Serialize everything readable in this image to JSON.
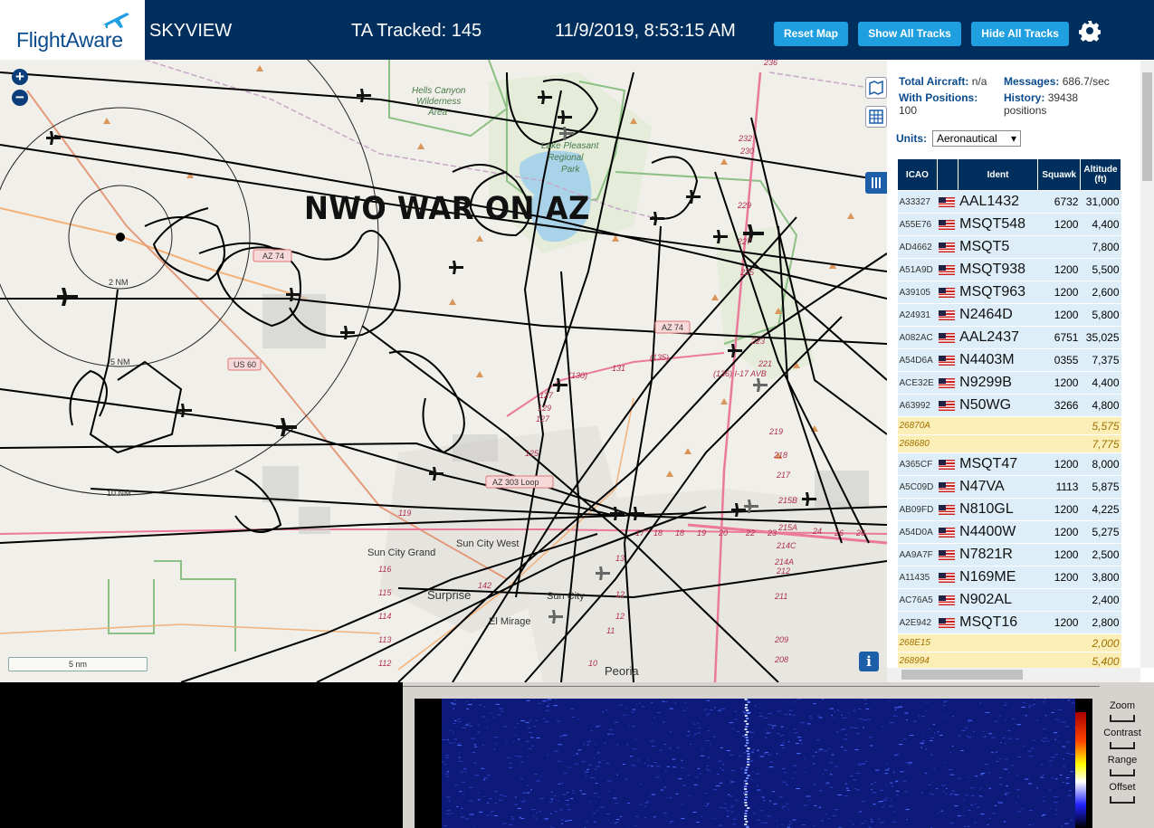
{
  "header": {
    "logo_text": "FlightAware",
    "app_title": "SKYVIEW",
    "ta_tracked": "TA Tracked: 145",
    "datetime": "11/9/2019, 8:53:15 AM",
    "reset_map": "Reset Map",
    "show_all_tracks": "Show All Tracks",
    "hide_all_tracks": "Hide All Tracks",
    "settings_icon": "gear-icon",
    "colors": {
      "bar": "#002f5d",
      "button": "#1f9fe0"
    }
  },
  "map": {
    "overlay_text": "NWO WAR ON AZ",
    "scale_label": "5 nm",
    "range_ring_labels": [
      "2 NM",
      "5 NM",
      "10 NM"
    ],
    "labels": {
      "hells_canyon": "Hells Canyon Wilderness Area",
      "lake_pleasant": "Lake Pleasant Regional Park",
      "sun_city_grand": "Sun City Grand",
      "sun_city_west": "Sun City West",
      "surprise": "Surprise",
      "sun_city": "Sun City",
      "el_mirage": "El Mirage",
      "peoria": "Peoria"
    },
    "road_shields": [
      "AZ 74",
      "US 60",
      "AZ 74",
      "AZ 303 Loop"
    ],
    "info_icon": "i",
    "icons": [
      "plus-icon",
      "minus-icon",
      "map-layers-icon",
      "grid-icon",
      "columns-icon",
      "info-icon"
    ]
  },
  "panel": {
    "total_aircraft_label": "Total Aircraft:",
    "total_aircraft_value": "n/a",
    "with_positions_label": "With Positions:",
    "with_positions_value": "100",
    "messages_label": "Messages:",
    "messages_value": "686.7/sec",
    "history_label": "History:",
    "history_value": "39438 positions",
    "units_label": "Units:",
    "units_value": "Aeronautical",
    "columns": [
      "ICAO",
      "",
      "Ident",
      "Squawk",
      "Altitude (ft)"
    ],
    "rows": [
      {
        "icao": "A33327",
        "ident": "AAL1432",
        "squawk": "6732",
        "alt": "31,000",
        "mlat": false
      },
      {
        "icao": "A55E76",
        "ident": "MSQT548",
        "squawk": "1200",
        "alt": "4,400",
        "mlat": false
      },
      {
        "icao": "AD4662",
        "ident": "MSQT5",
        "squawk": "",
        "alt": "7,800",
        "mlat": false
      },
      {
        "icao": "A51A9D",
        "ident": "MSQT938",
        "squawk": "1200",
        "alt": "5,500",
        "mlat": false
      },
      {
        "icao": "A39105",
        "ident": "MSQT963",
        "squawk": "1200",
        "alt": "2,600",
        "mlat": false
      },
      {
        "icao": "A24931",
        "ident": "N2464D",
        "squawk": "1200",
        "alt": "5,800",
        "mlat": false
      },
      {
        "icao": "A082AC",
        "ident": "AAL2437",
        "squawk": "6751",
        "alt": "35,025",
        "mlat": false
      },
      {
        "icao": "A54D6A",
        "ident": "N4403M",
        "squawk": "0355",
        "alt": "7,375",
        "mlat": false
      },
      {
        "icao": "ACE32E",
        "ident": "N9299B",
        "squawk": "1200",
        "alt": "4,400",
        "mlat": false
      },
      {
        "icao": "A63992",
        "ident": "N50WG",
        "squawk": "3266",
        "alt": "4,800",
        "mlat": false
      },
      {
        "icao": "26870A",
        "ident": "",
        "squawk": "",
        "alt": "5,575",
        "mlat": true
      },
      {
        "icao": "268680",
        "ident": "",
        "squawk": "",
        "alt": "7,775",
        "mlat": true
      },
      {
        "icao": "A365CF",
        "ident": "MSQT47",
        "squawk": "1200",
        "alt": "8,000",
        "mlat": false
      },
      {
        "icao": "A5C09D",
        "ident": "N47VA",
        "squawk": "1113",
        "alt": "5,875",
        "mlat": false
      },
      {
        "icao": "AB09FD",
        "ident": "N810GL",
        "squawk": "1200",
        "alt": "4,225",
        "mlat": false
      },
      {
        "icao": "A54D0A",
        "ident": "N4400W",
        "squawk": "1200",
        "alt": "5,275",
        "mlat": false
      },
      {
        "icao": "AA9A7F",
        "ident": "N7821R",
        "squawk": "1200",
        "alt": "2,500",
        "mlat": false
      },
      {
        "icao": "A11435",
        "ident": "N169ME",
        "squawk": "1200",
        "alt": "3,800",
        "mlat": false
      },
      {
        "icao": "AC76A5",
        "ident": "N902AL",
        "squawk": "",
        "alt": "2,400",
        "mlat": false
      },
      {
        "icao": "A2E942",
        "ident": "MSQT16",
        "squawk": "1200",
        "alt": "2,800",
        "mlat": false
      },
      {
        "icao": "268E15",
        "ident": "",
        "squawk": "",
        "alt": "2,000",
        "mlat": true
      },
      {
        "icao": "268994",
        "ident": "",
        "squawk": "",
        "alt": "5,400",
        "mlat": true
      }
    ]
  },
  "spectrum": {
    "controls": [
      "Zoom",
      "Contrast",
      "Range",
      "Offset"
    ]
  }
}
